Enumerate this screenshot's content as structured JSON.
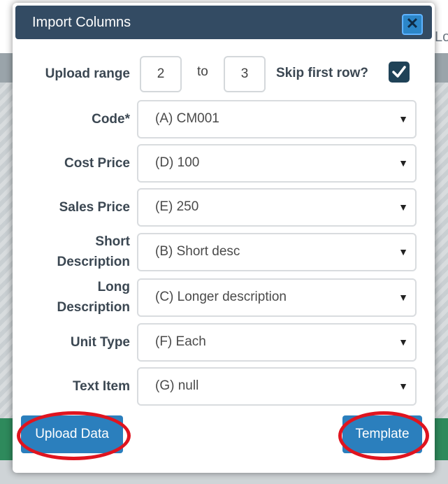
{
  "background": {
    "corner_text": "Lo"
  },
  "dialog": {
    "title": "Import Columns",
    "close_icon": "close-x-icon"
  },
  "upload_range": {
    "label": "Upload range",
    "from": "2",
    "to_label": "to",
    "to": "3",
    "skip_first_row_label": "Skip first row?",
    "skip_first_row_checked": true
  },
  "fields": [
    {
      "label_lines": [
        "Code*"
      ],
      "value": "(A) CM001"
    },
    {
      "label_lines": [
        "Cost Price"
      ],
      "value": "(D) 100"
    },
    {
      "label_lines": [
        "Sales Price"
      ],
      "value": "(E) 250"
    },
    {
      "label_lines": [
        "Short",
        "Description"
      ],
      "value": "(B) Short desc"
    },
    {
      "label_lines": [
        "Long",
        "Description"
      ],
      "value": "(C) Longer description"
    },
    {
      "label_lines": [
        "Unit Type"
      ],
      "value": "(F) Each"
    },
    {
      "label_lines": [
        "Text Item"
      ],
      "value": "(G) null"
    }
  ],
  "buttons": {
    "upload_data": "Upload Data",
    "template": "Template"
  },
  "colors": {
    "header": "#334b63",
    "button": "#2b7fbd",
    "highlight_ring": "#e0141f",
    "checkbox": "#1f4257"
  }
}
